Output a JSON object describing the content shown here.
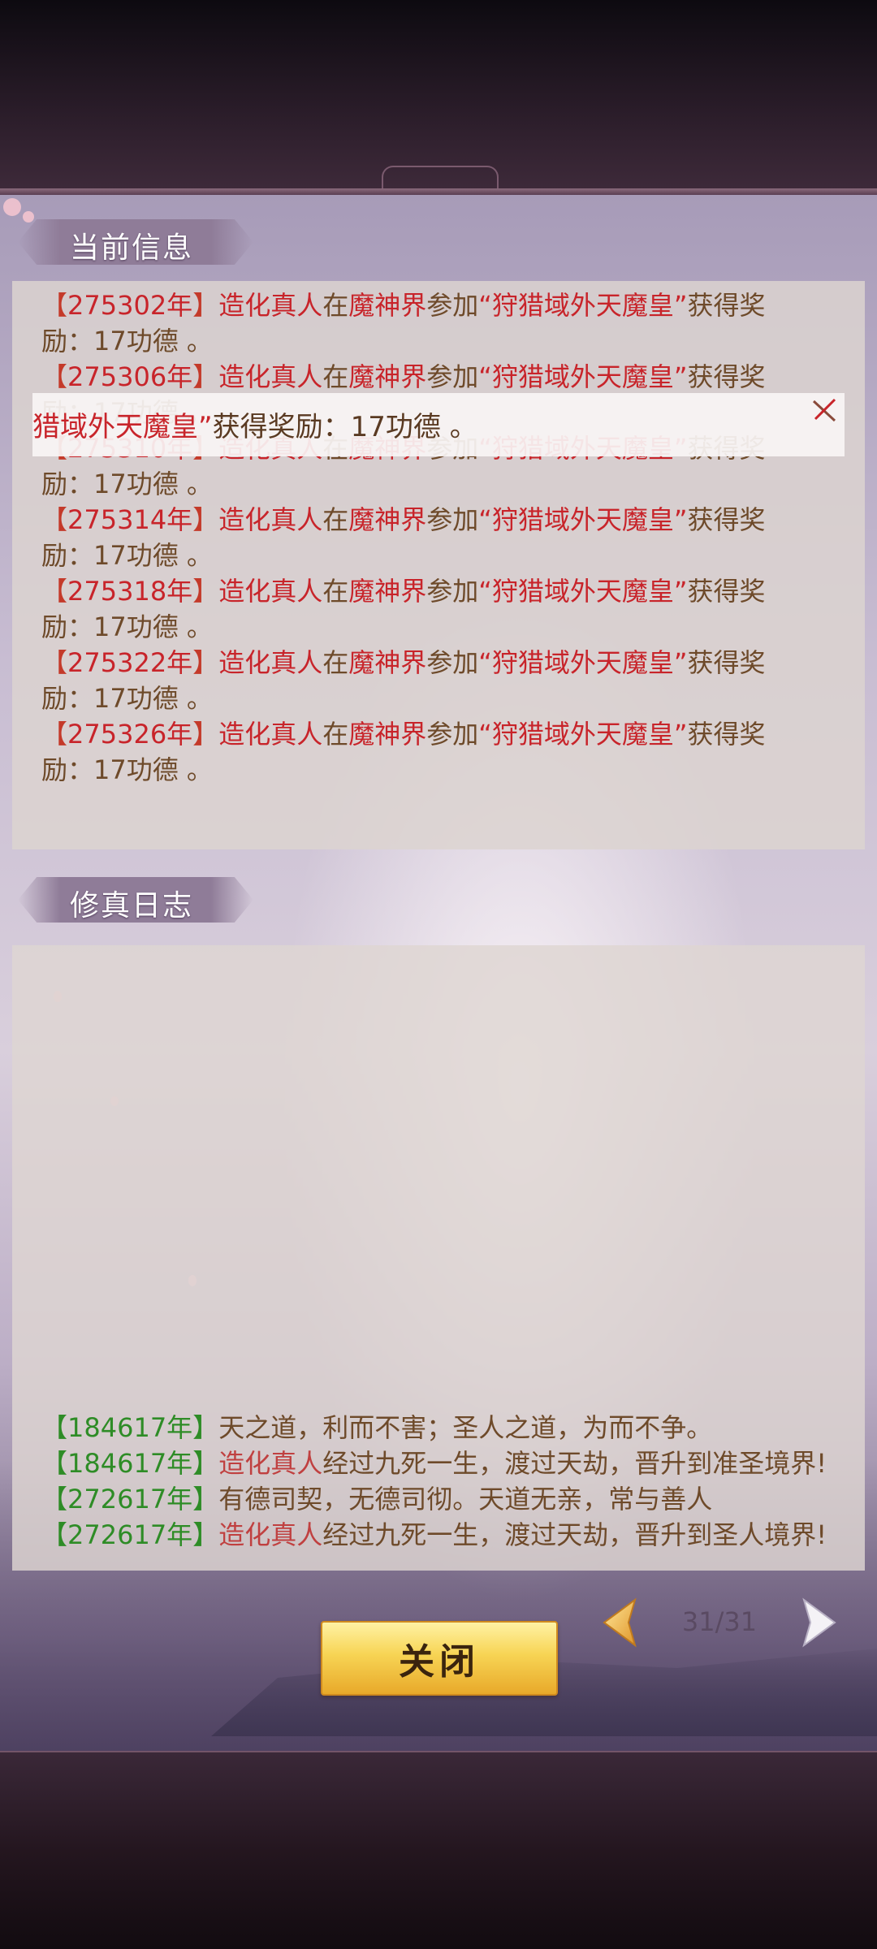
{
  "sections": {
    "current_info_title": "当前信息",
    "cultivation_log_title": "修真日志"
  },
  "current_info": {
    "top_partial_line": "励：17功德 。",
    "entries": [
      {
        "year": "275302年",
        "actor": "造化真人",
        "prep": "在",
        "place": "魔神界",
        "verb": "参加",
        "event": "“狩猎域外天魔皇”",
        "result": "获得奖",
        "reward": "励：17功德 。"
      },
      {
        "year": "275306年",
        "actor": "造化真人",
        "prep": "在",
        "place": "魔神界",
        "verb": "参加",
        "event": "“狩猎域外天魔皇”",
        "result": "获得奖",
        "reward": "励：17功德 。"
      },
      {
        "year": "275310年",
        "actor": "造化真人",
        "prep": "在",
        "place": "魔神界",
        "verb": "参加",
        "event": "“狩猎域外天魔皇”",
        "result": "获得奖",
        "reward": "励：17功德 。"
      },
      {
        "year": "275314年",
        "actor": "造化真人",
        "prep": "在",
        "place": "魔神界",
        "verb": "参加",
        "event": "“狩猎域外天魔皇”",
        "result": "获得奖",
        "reward": "励：17功德 。"
      },
      {
        "year": "275318年",
        "actor": "造化真人",
        "prep": "在",
        "place": "魔神界",
        "verb": "参加",
        "event": "“狩猎域外天魔皇”",
        "result": "获得奖",
        "reward": "励：17功德 。"
      },
      {
        "year": "275322年",
        "actor": "造化真人",
        "prep": "在",
        "place": "魔神界",
        "verb": "参加",
        "event": "“狩猎域外天魔皇”",
        "result": "获得奖",
        "reward": "励：17功德 。"
      },
      {
        "year": "275326年",
        "actor": "造化真人",
        "prep": "在",
        "place": "魔神界",
        "verb": "参加",
        "event": "“狩猎域外天魔皇”",
        "result": "获得奖",
        "reward": "励：17功德 。"
      }
    ]
  },
  "toast": {
    "event_part": "猎域外天魔皇”",
    "text_part": "获得奖励：17功德 。"
  },
  "cultivation_log": {
    "entries": [
      {
        "year": "184617年",
        "actor": "",
        "text": "天之道，利而不害；圣人之道，为而不争。"
      },
      {
        "year": "184617年",
        "actor": "造化真人",
        "text": "经过九死一生，渡过天劫，晋升到准圣境界!"
      },
      {
        "year": "272617年",
        "actor": "",
        "text": "有德司契，无德司彻。天道无亲，常与善人"
      },
      {
        "year": "272617年",
        "actor": "造化真人",
        "text": "经过九死一生，渡过天劫，晋升到圣人境界!"
      }
    ]
  },
  "footer": {
    "close_label": "关闭",
    "page_indicator": "31/31"
  },
  "colors": {
    "year_red": "#c8242a",
    "year_green": "#2e8c26",
    "body_brown": "#6e4a2a",
    "button_gold": "#f7d454"
  },
  "icons": {
    "prev": "chevron-left-icon",
    "next": "chevron-right-icon",
    "toast_close": "close-icon"
  }
}
